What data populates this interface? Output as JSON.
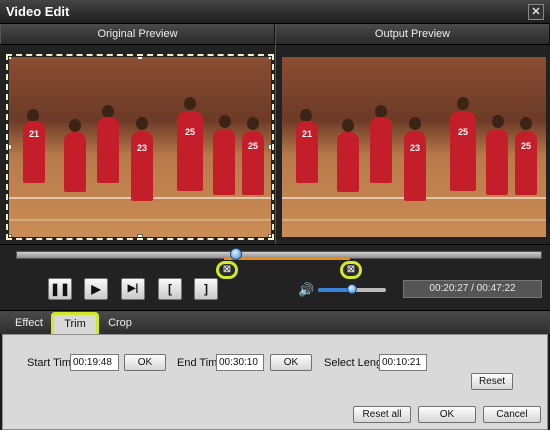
{
  "window": {
    "title": "Video Edit",
    "close_glyph": "✕"
  },
  "previews": {
    "original_label": "Original Preview",
    "output_label": "Output Preview"
  },
  "timeline": {
    "playhead_fraction": 0.43,
    "start_marker_icon": "trim-start-marker-icon",
    "end_marker_icon": "trim-end-marker-icon"
  },
  "controls": {
    "pause_glyph": "❚❚",
    "play_glyph": "▶",
    "next_frame_glyph": "▶|",
    "set_start_glyph": "[",
    "set_end_glyph": "]",
    "volume_glyph": "🔊",
    "volume_level": 0.5,
    "time_display": "00:20:27 / 00:47:22"
  },
  "tabs": [
    {
      "label": "Effect"
    },
    {
      "label": "Trim"
    },
    {
      "label": "Crop"
    }
  ],
  "trim": {
    "start_time_label": "Start Time",
    "start_time_value": "00:19:48",
    "end_time_label": "End Time",
    "end_time_value": "00:30:10",
    "select_length_label": "Select Length",
    "select_length_value": "00:10:21",
    "ok_label": "OK",
    "reset_label": "Reset"
  },
  "footer": {
    "reset_all_label": "Reset all",
    "ok_label": "OK",
    "cancel_label": "Cancel"
  },
  "colors": {
    "highlight": "#d4e82a",
    "accent": "#3a83d9",
    "range": "#e88a14"
  }
}
